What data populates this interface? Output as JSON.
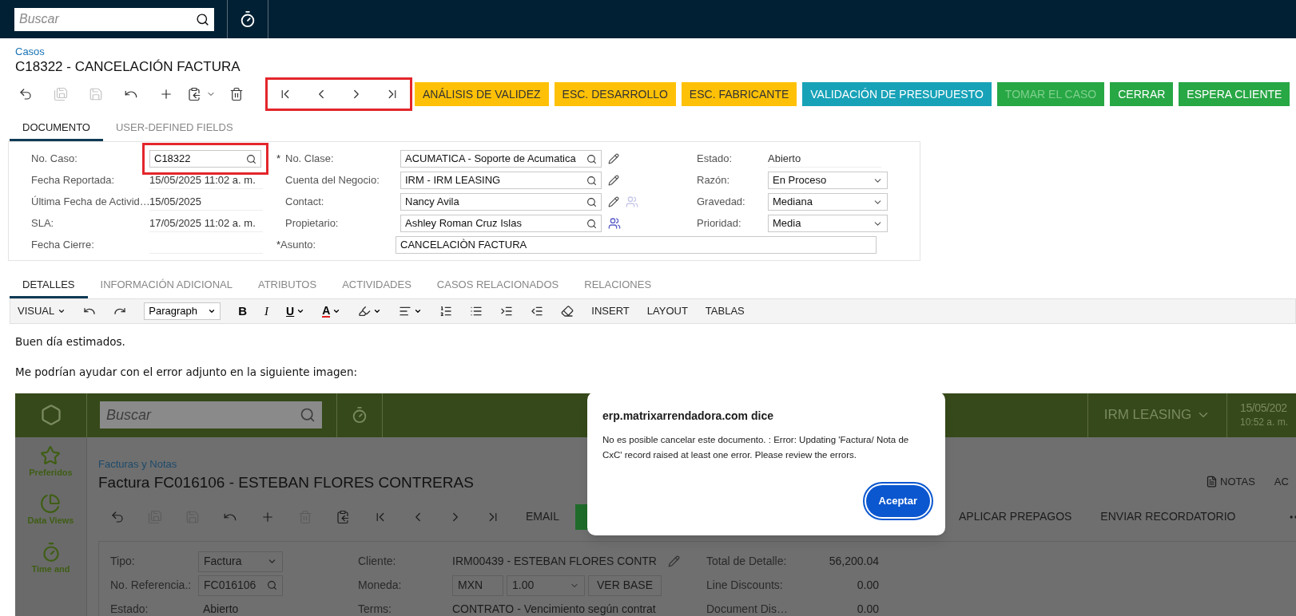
{
  "topbar": {
    "search_placeholder": "Buscar"
  },
  "breadcrumb": "Casos",
  "title": "C18322 - CANCELACIÓN FACTURA",
  "toolbar": {
    "icons": [
      {
        "kind": "back",
        "disabled": false
      },
      {
        "kind": "save-close",
        "disabled": true
      },
      {
        "kind": "save",
        "disabled": true
      },
      {
        "kind": "undo",
        "disabled": false
      },
      {
        "kind": "add",
        "disabled": false
      },
      {
        "kind": "copy",
        "disabled": false
      },
      {
        "kind": "delete",
        "disabled": false
      }
    ],
    "nav": {
      "annotated": true,
      "items": [
        {
          "kind": "first"
        },
        {
          "kind": "prev"
        },
        {
          "kind": "next"
        },
        {
          "kind": "last"
        }
      ]
    },
    "actions": [
      {
        "label": "ANÁLISIS DE VALIDEZ",
        "color": "#ffc107",
        "disabled": false
      },
      {
        "label": "ESC. DESARROLLO",
        "color": "#ffc107",
        "disabled": false
      },
      {
        "label": "ESC. FABRICANTE",
        "color": "#ffc107",
        "disabled": false
      },
      {
        "label": "VALIDACIÓN DE PRESUPUESTO",
        "color": "#17a2b8",
        "disabled": false
      },
      {
        "label": "TOMAR EL CASO",
        "color": "#28a745",
        "disabled": true
      },
      {
        "label": "CERRAR",
        "color": "#28a745",
        "disabled": false
      },
      {
        "label": "ESPERA CLIENTE",
        "color": "#28a745",
        "disabled": false
      }
    ]
  },
  "tabs": [
    {
      "label": "DOCUMENTO",
      "selected": true
    },
    {
      "label": "USER-DEFINED FIELDS",
      "selected": false
    }
  ],
  "form": {
    "col1": [
      {
        "label": "No. Caso:",
        "value": "C18322",
        "kind": "lookup",
        "annotated": true
      },
      {
        "label": "Fecha Reportada:",
        "value": "15/05/2025 11:02 a. m.",
        "kind": "text"
      },
      {
        "label": "Última Fecha de Activid…",
        "value": "15/05/2025",
        "kind": "text"
      },
      {
        "label": "SLA:",
        "value": "17/05/2025 11:02 a. m.",
        "kind": "text"
      },
      {
        "label": "Fecha Cierre:",
        "kind": "text"
      }
    ],
    "col2": [
      {
        "marker": "*",
        "label": "No. Clase:",
        "value": "ACUMATICA - Soporte de Acumatica",
        "kind": "lookup",
        "editable": true
      },
      {
        "label": "Cuenta del Negocio:",
        "value": "IRM - IRM LEASING",
        "kind": "lookup",
        "editable": true
      },
      {
        "label": "Contact:",
        "value": "Nancy Avila",
        "kind": "lookup",
        "editable": true,
        "teams": false
      },
      {
        "label": "Propietario:",
        "value": "Ashley Roman Cruz Islas",
        "kind": "lookup",
        "teams": true
      },
      {
        "marker": "*",
        "label": "Asunto:",
        "value": "CANCELACIÒN FACTURA",
        "kind": "wide"
      }
    ],
    "col3": [
      {
        "label": "Estado:",
        "value": "Abierto",
        "kind": "text"
      },
      {
        "label": "Razón:",
        "value": "En Proceso",
        "kind": "select"
      },
      {
        "label": "Gravedad:",
        "value": "Mediana",
        "kind": "select"
      },
      {
        "label": "Prioridad:",
        "value": "Media",
        "kind": "select"
      }
    ]
  },
  "detail_tabs": [
    {
      "label": "DETALLES",
      "selected": true
    },
    {
      "label": "INFORMACIÓN ADICIONAL",
      "selected": false
    },
    {
      "label": "ATRIBUTOS",
      "selected": false
    },
    {
      "label": "ACTIVIDADES",
      "selected": false
    },
    {
      "label": "CASOS RELACIONADOS",
      "selected": false
    },
    {
      "label": "RELACIONES",
      "selected": false
    }
  ],
  "editor_toolbar": [
    {
      "kind": "menu",
      "label": "VISUAL"
    },
    {
      "kind": "undo"
    },
    {
      "kind": "redo"
    },
    {
      "kind": "select",
      "value": "Paragraph"
    },
    {
      "kind": "bold",
      "label": "B"
    },
    {
      "kind": "italic",
      "label": "I"
    },
    {
      "kind": "underline",
      "label": "U"
    },
    {
      "kind": "font-color",
      "label": "A"
    },
    {
      "kind": "highlight"
    },
    {
      "kind": "align"
    },
    {
      "kind": "ordered-list"
    },
    {
      "kind": "bullet-list"
    },
    {
      "kind": "indent"
    },
    {
      "kind": "outdent"
    },
    {
      "kind": "clear-format"
    },
    {
      "kind": "text",
      "label": "INSERT"
    },
    {
      "kind": "text",
      "label": "LAYOUT"
    },
    {
      "kind": "text",
      "label": "TABLAS"
    }
  ],
  "paragraphs": [
    "Buen día estimados.",
    "Me podrían ayudar con el error adjunto en la siguiente imagen:"
  ],
  "attachment": {
    "topbar": {
      "search_placeholder": "Buscar",
      "company": "IRM LEASING",
      "date": "15/05/202",
      "time": "10:52 a. m."
    },
    "sidebar": [
      {
        "kind": "star",
        "label": "Preferidos"
      },
      {
        "kind": "chart",
        "label": "Data Views"
      },
      {
        "kind": "timer",
        "label": "Time and"
      }
    ],
    "breadcrumb": "Facturas y Notas",
    "title": "Factura FC016106 - ESTEBAN FLORES CONTRERAS",
    "links": [
      {
        "kind": "note",
        "label": "NOTAS"
      },
      {
        "kind": "text",
        "label": "AC"
      }
    ],
    "toolbar": [
      {
        "kind": "back",
        "disabled": false
      },
      {
        "kind": "save-close",
        "disabled": true
      },
      {
        "kind": "save",
        "disabled": true
      },
      {
        "kind": "undo",
        "disabled": false
      },
      {
        "kind": "add",
        "disabled": false
      },
      {
        "kind": "delete",
        "disabled": true
      },
      {
        "kind": "copy",
        "disabled": false
      },
      {
        "kind": "first",
        "disabled": false
      },
      {
        "kind": "prev",
        "disabled": false
      },
      {
        "kind": "next",
        "disabled": false
      },
      {
        "kind": "last",
        "disabled": false
      }
    ],
    "email": "EMAIL",
    "actions": [
      "APLICAR PREPAGOS",
      "ENVIAR RECORDATORIO"
    ],
    "col1": [
      {
        "label": "Tipo:",
        "value": "Factura",
        "kind": "select"
      },
      {
        "label": "No. Referencia.:",
        "value": "FC016106",
        "kind": "lookup"
      },
      {
        "label": "Estado:",
        "value": "Abierto",
        "kind": "text"
      }
    ],
    "cliente": {
      "label": "Cliente:",
      "value": "IRM00439 - ESTEBAN FLORES CONTR"
    },
    "moneda": {
      "label": "Moneda:",
      "currency": "MXN",
      "rate": "1.00",
      "button": "VER BASE"
    },
    "terms": {
      "label": "Terms:",
      "value": "CONTRATO - Vencimiento según contrat"
    },
    "totals": [
      {
        "label": "Total de Detalle:",
        "value": "56,200.04"
      },
      {
        "label": "Line Discounts:",
        "value": "0.00"
      },
      {
        "label": "Document Dis…",
        "value": "0.00"
      }
    ],
    "dialog": {
      "title": "erp.matrixarrendadora.com dice",
      "message": "No es posible cancelar este documento. : Error: Updating  'Factura/ Nota de CxC' record raised at least one error. Please review the errors.",
      "button": "Aceptar"
    }
  }
}
